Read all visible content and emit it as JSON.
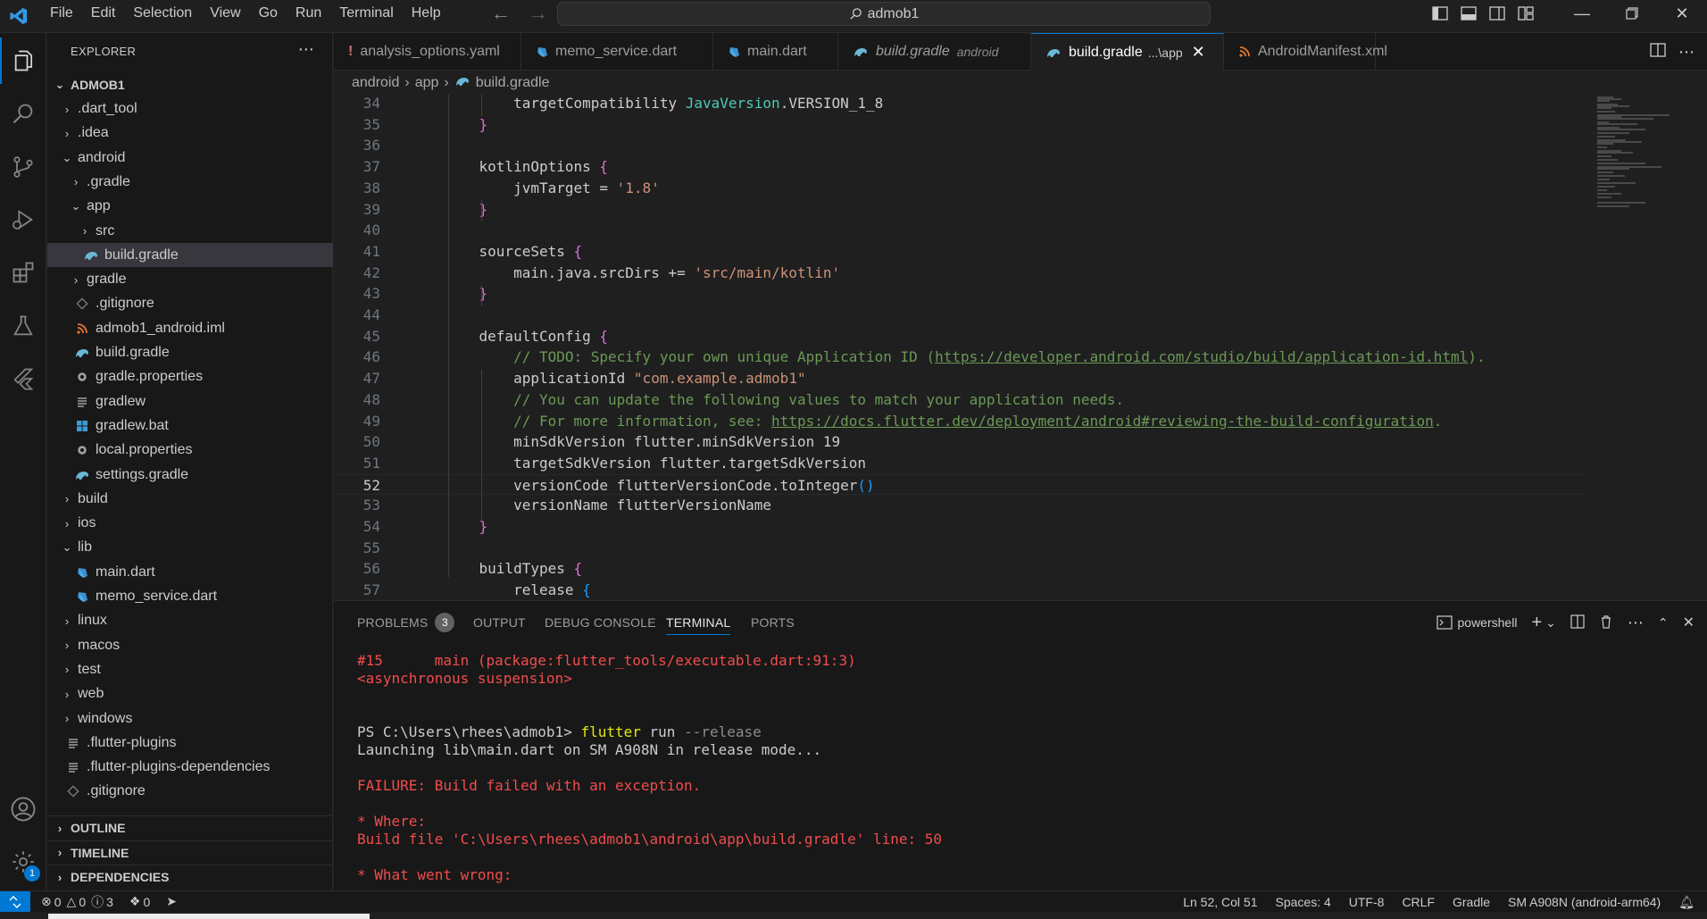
{
  "titlebar": {
    "menus": [
      "File",
      "Edit",
      "Selection",
      "View",
      "Go",
      "Run",
      "Terminal",
      "Help"
    ],
    "search": "admob1"
  },
  "sidebar": {
    "title": "EXPLORER",
    "root": "ADMOB1",
    "tree": [
      {
        "label": ".dart_tool",
        "depth": 1,
        "kind": "folder",
        "open": false
      },
      {
        "label": ".idea",
        "depth": 1,
        "kind": "folder",
        "open": false
      },
      {
        "label": "android",
        "depth": 1,
        "kind": "folder",
        "open": true
      },
      {
        "label": ".gradle",
        "depth": 2,
        "kind": "folder",
        "open": false
      },
      {
        "label": "app",
        "depth": 2,
        "kind": "folder",
        "open": true
      },
      {
        "label": "src",
        "depth": 3,
        "kind": "folder",
        "open": false
      },
      {
        "label": "build.gradle",
        "depth": 3,
        "kind": "gradle",
        "selected": true
      },
      {
        "label": "gradle",
        "depth": 2,
        "kind": "folder",
        "open": false
      },
      {
        "label": ".gitignore",
        "depth": 2,
        "kind": "git"
      },
      {
        "label": "admob1_android.iml",
        "depth": 2,
        "kind": "rss"
      },
      {
        "label": "build.gradle",
        "depth": 2,
        "kind": "gradle"
      },
      {
        "label": "gradle.properties",
        "depth": 2,
        "kind": "gear"
      },
      {
        "label": "gradlew",
        "depth": 2,
        "kind": "lines"
      },
      {
        "label": "gradlew.bat",
        "depth": 2,
        "kind": "windows"
      },
      {
        "label": "local.properties",
        "depth": 2,
        "kind": "gear"
      },
      {
        "label": "settings.gradle",
        "depth": 2,
        "kind": "gradle"
      },
      {
        "label": "build",
        "depth": 1,
        "kind": "folder",
        "open": false
      },
      {
        "label": "ios",
        "depth": 1,
        "kind": "folder",
        "open": false
      },
      {
        "label": "lib",
        "depth": 1,
        "kind": "folder",
        "open": true
      },
      {
        "label": "main.dart",
        "depth": 2,
        "kind": "dart"
      },
      {
        "label": "memo_service.dart",
        "depth": 2,
        "kind": "dart"
      },
      {
        "label": "linux",
        "depth": 1,
        "kind": "folder",
        "open": false
      },
      {
        "label": "macos",
        "depth": 1,
        "kind": "folder",
        "open": false
      },
      {
        "label": "test",
        "depth": 1,
        "kind": "folder",
        "open": false
      },
      {
        "label": "web",
        "depth": 1,
        "kind": "folder",
        "open": false
      },
      {
        "label": "windows",
        "depth": 1,
        "kind": "folder",
        "open": false
      },
      {
        "label": ".flutter-plugins",
        "depth": 1,
        "kind": "lines"
      },
      {
        "label": ".flutter-plugins-dependencies",
        "depth": 1,
        "kind": "lines"
      },
      {
        "label": ".gitignore",
        "depth": 1,
        "kind": "git"
      }
    ],
    "sections": [
      "OUTLINE",
      "TIMELINE",
      "DEPENDENCIES"
    ]
  },
  "tabs": [
    {
      "label": "analysis_options.yaml",
      "icon": "exclamation-icon",
      "desc": ""
    },
    {
      "label": "memo_service.dart",
      "icon": "dart-icon",
      "desc": ""
    },
    {
      "label": "main.dart",
      "icon": "dart-icon",
      "desc": ""
    },
    {
      "label": "build.gradle",
      "icon": "gradle-icon",
      "desc": "android",
      "italic": true
    },
    {
      "label": "build.gradle",
      "icon": "gradle-icon",
      "desc": "...\\app",
      "active": true
    },
    {
      "label": "AndroidManifest.xml",
      "icon": "rss-icon",
      "desc": ""
    }
  ],
  "breadcrumb": [
    "android",
    "app",
    "build.gradle"
  ],
  "editor": {
    "current_line": 52,
    "lines": [
      {
        "n": 34,
        "html": "        targetCompatibility <span class='k-teal'>JavaVersion</span>.VERSION_1_8"
      },
      {
        "n": 35,
        "html": "    <span class='k-brace'>}</span>"
      },
      {
        "n": 36,
        "html": ""
      },
      {
        "n": 37,
        "html": "    kotlinOptions <span class='k-brace'>{</span>"
      },
      {
        "n": 38,
        "html": "        jvmTarget = <span class='k-str'>'1.8'</span>"
      },
      {
        "n": 39,
        "html": "    <span class='k-brace'>}</span>"
      },
      {
        "n": 40,
        "html": ""
      },
      {
        "n": 41,
        "html": "    sourceSets <span class='k-brace'>{</span>"
      },
      {
        "n": 42,
        "html": "        main.java.srcDirs += <span class='k-str'>'src/main/kotlin'</span>"
      },
      {
        "n": 43,
        "html": "    <span class='k-brace'>}</span>"
      },
      {
        "n": 44,
        "html": ""
      },
      {
        "n": 45,
        "html": "    defaultConfig <span class='k-brace'>{</span>"
      },
      {
        "n": 46,
        "html": "        <span class='k-cmt'>// TODO: Specify your own unique Application ID (<span class='k-link'>https://developer.android.com/studio/build/application-id.html</span>).</span>"
      },
      {
        "n": 47,
        "html": "        applicationId <span class='k-str'>\"com.example.admob1\"</span>"
      },
      {
        "n": 48,
        "html": "        <span class='k-cmt'>// You can update the following values to match your application needs.</span>"
      },
      {
        "n": 49,
        "html": "        <span class='k-cmt'>// For more information, see: <span class='k-link'>https://docs.flutter.dev/deployment/android#reviewing-the-build-configuration</span>.</span>"
      },
      {
        "n": 50,
        "html": "        minSdkVersion flutter.minSdkVersion 19"
      },
      {
        "n": 51,
        "html": "        targetSdkVersion flutter.targetSdkVersion"
      },
      {
        "n": 52,
        "html": "        versionCode flutterVersionCode.toInteger<span class='k-brace2'>()</span>"
      },
      {
        "n": 53,
        "html": "        versionName flutterVersionName"
      },
      {
        "n": 54,
        "html": "    <span class='k-brace'>}</span>"
      },
      {
        "n": 55,
        "html": ""
      },
      {
        "n": 56,
        "html": "    buildTypes <span class='k-brace'>{</span>"
      },
      {
        "n": 57,
        "html": "        release <span class='k-brace2'>{</span>"
      }
    ]
  },
  "panel": {
    "tabs": [
      "PROBLEMS",
      "OUTPUT",
      "DEBUG CONSOLE",
      "TERMINAL",
      "PORTS"
    ],
    "problems_count": "3",
    "shell": "powershell",
    "terminal": [
      {
        "html": "<span class='t-red'>#15      main (package:flutter_tools/executable.dart:91:3)</span>"
      },
      {
        "html": "<span class='t-red'>&lt;asynchronous suspension&gt;</span>"
      },
      {
        "html": ""
      },
      {
        "html": ""
      },
      {
        "html": "PS C:\\Users\\rhees\\admob1&gt; <span class='t-yel'>flutter</span> run <span class='t-gray'>--release</span>"
      },
      {
        "html": "Launching lib\\main.dart on SM A908N in release mode..."
      },
      {
        "html": ""
      },
      {
        "html": "<span class='t-red'>FAILURE: Build failed with an exception.</span>"
      },
      {
        "html": ""
      },
      {
        "html": "<span class='t-red'>* Where:</span>"
      },
      {
        "html": "<span class='t-red'>Build file 'C:\\Users\\rhees\\admob1\\android\\app\\build.gradle' line: 50</span>"
      },
      {
        "html": ""
      },
      {
        "html": "<span class='t-red'>* What went wrong:</span>"
      }
    ]
  },
  "status": {
    "errors": "0",
    "warnings": "0",
    "info": "3",
    "ports": "0",
    "position": "Ln 52, Col 51",
    "spaces": "Spaces: 4",
    "encoding": "UTF-8",
    "eol": "CRLF",
    "language": "Gradle",
    "device": "SM A908N (android-arm64)",
    "account_badge": "1"
  },
  "colors": {
    "accent": "#0078d4",
    "error": "#f14c4c",
    "editor_bg": "#1f1f1f",
    "sidebar_bg": "#181818"
  }
}
